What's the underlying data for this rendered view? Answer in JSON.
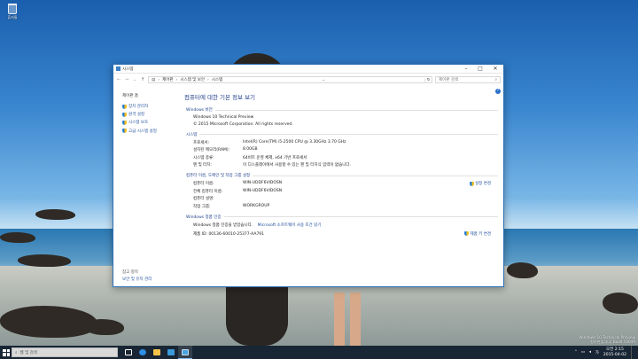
{
  "desktop": {
    "recycle_bin_label": "휴지통",
    "watermark": [
      "Windows 10 Technical Preview",
      "평가판입니다. Build 10049"
    ]
  },
  "window": {
    "title": "시스템",
    "breadcrumb": [
      "제어판",
      "시스템 및 보안",
      "시스템"
    ],
    "search_placeholder": "제어판 검색",
    "sidebar": {
      "home": "제어판 홈",
      "items": [
        {
          "label": "장치 관리자",
          "icon": "shield-icon"
        },
        {
          "label": "원격 설정",
          "icon": "shield-icon"
        },
        {
          "label": "시스템 보호",
          "icon": "shield-icon"
        },
        {
          "label": "고급 시스템 설정",
          "icon": "shield-icon"
        }
      ],
      "see_also_heading": "참고 항목",
      "see_also_link": "보안 및 유지 관리"
    },
    "page_title": "컴퓨터에 대한 기본 정보 보기",
    "edition": {
      "heading": "Windows 버전",
      "name": "Windows 10 Technical Preview",
      "copyright": "© 2015 Microsoft Corporation. All rights reserved."
    },
    "system": {
      "heading": "시스템",
      "rows": [
        {
          "k": "프로세서:",
          "v": "Intel(R) Core(TM) i5-2500 CPU @ 3.30GHz   3.70 GHz"
        },
        {
          "k": "설치된 메모리(RAM):",
          "v": "8.00GB"
        },
        {
          "k": "시스템 종류:",
          "v": "64비트 운영 체제, x64 기반 프로세서"
        },
        {
          "k": "펜 및 터치:",
          "v": "이 디스플레이에서 사용할 수 있는 펜 및 터치식 입력이 없습니다."
        }
      ]
    },
    "computer_name": {
      "heading": "컴퓨터 이름, 도메인 및 작업 그룹 설정",
      "change_settings": "설정 변경",
      "rows": [
        {
          "k": "컴퓨터 이름:",
          "v": "WIN-UDDF6VIDOSN"
        },
        {
          "k": "전체 컴퓨터 이름:",
          "v": "WIN-UDDF6VIDOSN"
        },
        {
          "k": "컴퓨터 설명:",
          "v": ""
        },
        {
          "k": "작업 그룹:",
          "v": "WORKGROUP"
        }
      ]
    },
    "activation": {
      "heading": "Windows 정품 인증",
      "status_prefix": "Windows 정품 인증을 받았습니다.",
      "status_link": "Microsoft 소프트웨어 사용 조건 읽기",
      "product_id": "제품 ID: 00136-60010-25377-AA791",
      "change_key": "제품 키 변경"
    }
  },
  "taskbar": {
    "search_placeholder": "웹 및 검색",
    "clock_time": "오전 2:15",
    "clock_date": "2015-04-02"
  }
}
